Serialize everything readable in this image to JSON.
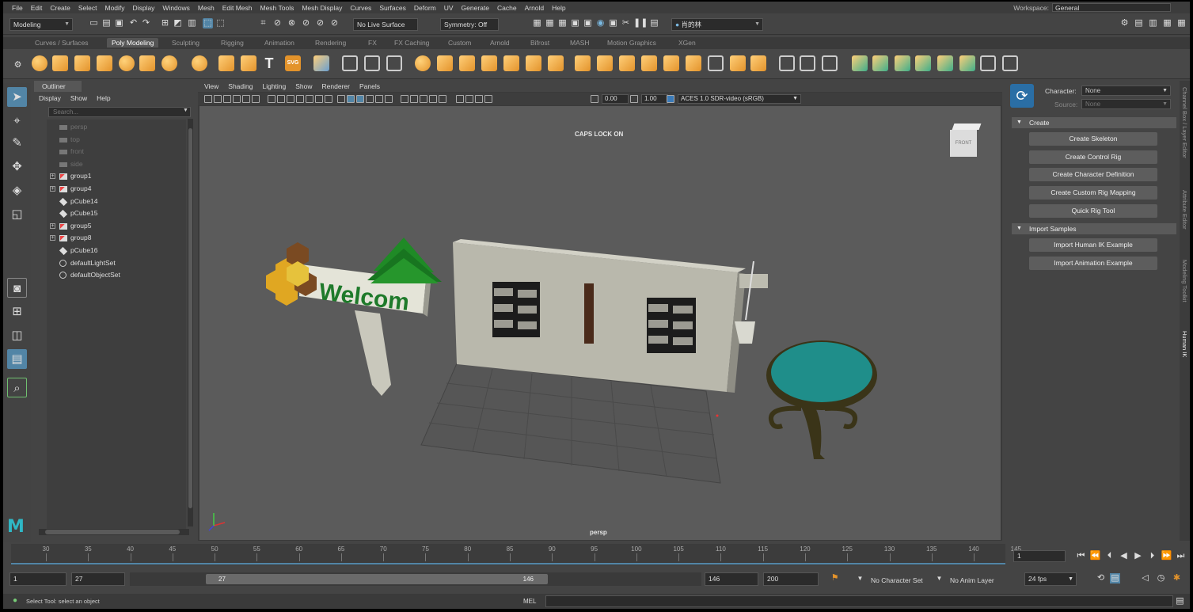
{
  "menubar": {
    "items": [
      "File",
      "Edit",
      "Create",
      "Select",
      "Modify",
      "Display",
      "Windows",
      "Mesh",
      "Edit Mesh",
      "Mesh Tools",
      "Mesh Display",
      "Curves",
      "Surfaces",
      "Deform",
      "UV",
      "Generate",
      "Cache",
      "Arnold",
      "Help"
    ],
    "workspace_label": "Workspace:",
    "workspace_value": "General"
  },
  "statusline": {
    "mode": "Modeling",
    "live_surface": "No Live Surface",
    "symmetry": "Symmetry: Off",
    "user": "肖的林"
  },
  "shelf": {
    "tabs": [
      "Curves / Surfaces",
      "Poly Modeling",
      "Sculpting",
      "Rigging",
      "Animation",
      "Rendering",
      "FX",
      "FX Caching",
      "Custom",
      "Arnold",
      "Bifrost",
      "MASH",
      "Motion Graphics",
      "XGen"
    ],
    "active_tab": "Poly Modeling",
    "text_label": "T",
    "svg_label": "SVG"
  },
  "outliner": {
    "title": "Outliner",
    "menu": [
      "Display",
      "Show",
      "Help"
    ],
    "search_placeholder": "Search...",
    "items": [
      {
        "label": "persp",
        "dim": true,
        "expand": false,
        "type": "camera"
      },
      {
        "label": "top",
        "dim": true,
        "expand": false,
        "type": "camera"
      },
      {
        "label": "front",
        "dim": true,
        "expand": false,
        "type": "camera"
      },
      {
        "label": "side",
        "dim": true,
        "expand": false,
        "type": "camera"
      },
      {
        "label": "group1",
        "dim": false,
        "expand": true,
        "type": "group"
      },
      {
        "label": "group4",
        "dim": false,
        "expand": true,
        "type": "group"
      },
      {
        "label": "pCube14",
        "dim": false,
        "expand": false,
        "type": "mesh"
      },
      {
        "label": "pCube15",
        "dim": false,
        "expand": false,
        "type": "mesh"
      },
      {
        "label": "group5",
        "dim": false,
        "expand": true,
        "type": "group"
      },
      {
        "label": "group8",
        "dim": false,
        "expand": true,
        "type": "group"
      },
      {
        "label": "pCube16",
        "dim": false,
        "expand": false,
        "type": "mesh"
      },
      {
        "label": "defaultLightSet",
        "dim": false,
        "expand": false,
        "type": "set"
      },
      {
        "label": "defaultObjectSet",
        "dim": false,
        "expand": false,
        "type": "set"
      }
    ]
  },
  "viewport": {
    "menu": [
      "View",
      "Shading",
      "Lighting",
      "Show",
      "Renderer",
      "Panels"
    ],
    "exposure": "0.00",
    "gamma": "1.00",
    "color_space": "ACES 1.0 SDR-video (sRGB)",
    "caps_lock": "CAPS LOCK ON",
    "camera_label": "persp",
    "sign_text": "Welcom",
    "viewcube_label": "FRONT"
  },
  "character_panel": {
    "character_label": "Character:",
    "character_value": "None",
    "source_label": "Source:",
    "source_value": "None",
    "create_section": "Create",
    "create_buttons": [
      "Create Skeleton",
      "Create Control Rig",
      "Create Character Definition",
      "Create Custom Rig Mapping",
      "Quick Rig Tool"
    ],
    "import_section": "Import Samples",
    "import_buttons": [
      "Import Human IK Example",
      "Import Animation Example"
    ]
  },
  "side_tabs": [
    "Channel Box / Layer Editor",
    "Attribute Editor",
    "Modeling Toolkit",
    "Human IK"
  ],
  "side_tab_active": "Human IK",
  "timeline": {
    "ticks": [
      "30",
      "35",
      "40",
      "45",
      "50",
      "55",
      "60",
      "65",
      "70",
      "75",
      "80",
      "85",
      "90",
      "95",
      "100",
      "105",
      "110",
      "115",
      "120",
      "125",
      "130",
      "135",
      "140",
      "145"
    ],
    "tick_start": 30,
    "tick_end": 146,
    "current_frame": "1"
  },
  "range": {
    "start": "1",
    "playback_start": "27",
    "range_start_label": "27",
    "range_end_label": "146",
    "playback_end": "146",
    "end": "200",
    "character_set": "No Character Set",
    "anim_layer": "No Anim Layer",
    "fps": "24 fps"
  },
  "helpline": {
    "text": "Select Tool: select an object",
    "mel_label": "MEL"
  },
  "colors": {
    "accent_blue": "#5285a6",
    "viewport_bg": "#5b5b5b",
    "shelf_orange": "#e3932b",
    "shelf_teal": "#3fae8a"
  }
}
